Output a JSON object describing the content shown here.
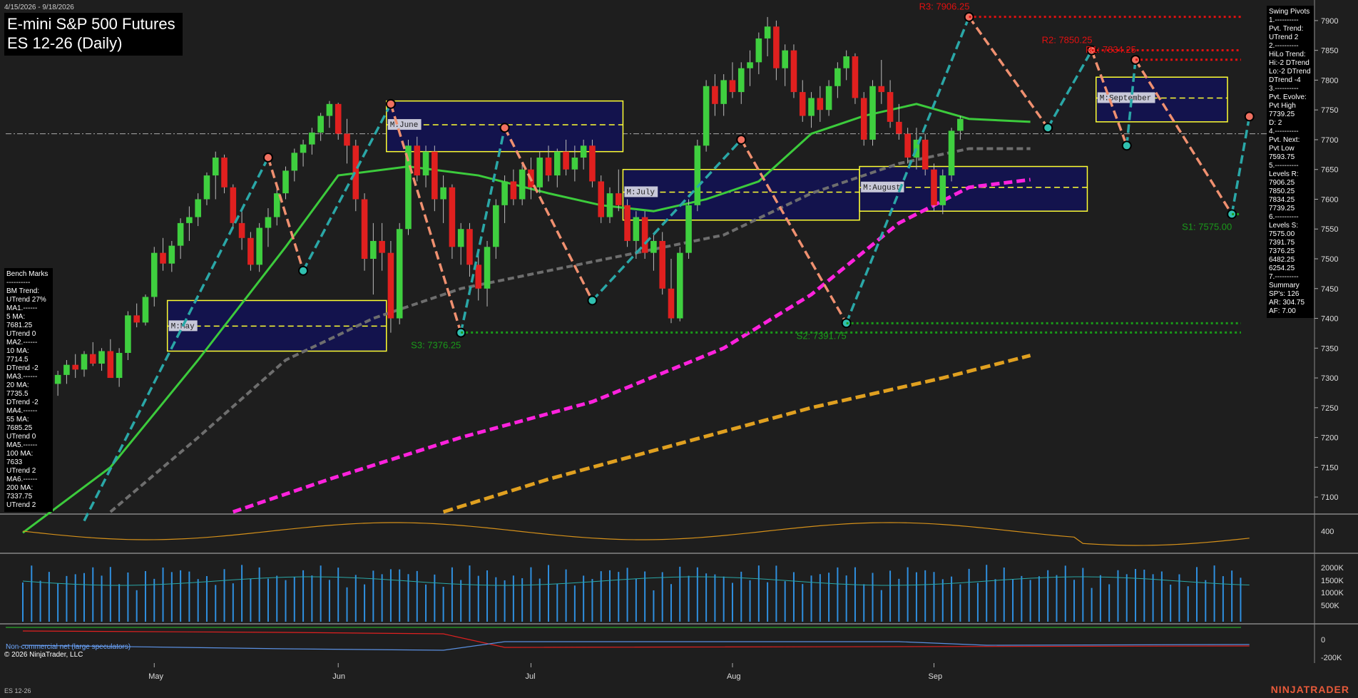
{
  "header": {
    "date_range": "4/15/2026 - 9/18/2026",
    "title_line1": "E-mini S&P 500 Futures",
    "title_line2": "ES 12-26 (Daily)"
  },
  "benchmarks": {
    "lines": [
      "Bench Marks",
      "----------",
      "BM Trend:",
      "UTrend 27%",
      "MA1.------",
      "5 MA:",
      "7681.25",
      "UTrend 0",
      "MA2.------",
      "10 MA:",
      "7714.5",
      "DTrend -2",
      "MA3.------",
      "20 MA:",
      "7735.5",
      "DTrend -2",
      "MA4.------",
      "55 MA:",
      "7685.25",
      "UTrend 0",
      "MA5.------",
      "100 MA:",
      "7633",
      "UTrend 2",
      "MA6.------",
      "200 MA:",
      "7337.75",
      "UTrend 2"
    ]
  },
  "swing_pivots": {
    "lines": [
      "Swing Pivots",
      "1.----------",
      "Pvt. Trend:",
      "UTrend 2",
      "2.----------",
      "HiLo Trend:",
      "Hi:-2 DTrend",
      "Lo:-2 DTrend",
      "DTrend -4",
      "3.----------",
      "Pvt. Evolve:",
      "Pvt High",
      "7739.25",
      "D: 2",
      "4.----------",
      "Pvt. Next:",
      "Pvt Low",
      "7593.75",
      "5.----------",
      "Levels R:",
      "7906.25",
      "7850.25",
      "7834.25",
      "7739.25",
      "6.----------",
      "Levels S:",
      "7575.00",
      "7391.75",
      "7376.25",
      "6482.25",
      "6254.25",
      "7.----------",
      "Summary",
      "SP's: 126",
      "AR: 304.75",
      "AF: 7.00"
    ]
  },
  "footer": {
    "symbol": "ES 12-26",
    "copyright": "© 2026 NinjaTrader, LLC",
    "cot_label": "Non-commercial net (large speculators)",
    "brand": "NINJATRADER"
  },
  "colors": {
    "background": "#1e1e1e",
    "up_candle": "#3fcf3f",
    "down_candle": "#e0201f",
    "ma20": "#3ccb3c",
    "ma55": "#6e6e6e",
    "ma100": "#ff22dd",
    "ma200": "#e0a020",
    "swing_up": "#2aa7a7",
    "swing_down": "#f09070",
    "resistance": "#e01010",
    "support": "#1a9a1a",
    "value_area_fill": "#13134d",
    "value_area_border": "#ffff33",
    "volume": "#2f8fdf"
  },
  "chart_data": {
    "type": "candlestick",
    "title": "E-mini S&P 500 Futures ES 12-26 (Daily)",
    "x_axis": {
      "months": [
        {
          "label": "May",
          "bar": 15
        },
        {
          "label": "Jun",
          "bar": 36
        },
        {
          "label": "Jul",
          "bar": 58
        },
        {
          "label": "Aug",
          "bar": 81
        },
        {
          "label": "Sep",
          "bar": 104
        }
      ]
    },
    "y_axis": {
      "ticks": [
        7100,
        7150,
        7200,
        7250,
        7300,
        7350,
        7400,
        7450,
        7500,
        7550,
        7600,
        7650,
        7700,
        7750,
        7800,
        7850,
        7900
      ],
      "range": [
        7075,
        7925
      ]
    },
    "close_line": 7710,
    "ohlc": [
      [
        7292,
        7315,
        7248,
        7262
      ],
      [
        7262,
        7288,
        7230,
        7280
      ],
      [
        7280,
        7302,
        7268,
        7298
      ],
      [
        7298,
        7326,
        7286,
        7290
      ],
      [
        7290,
        7312,
        7270,
        7305
      ],
      [
        7305,
        7330,
        7290,
        7322
      ],
      [
        7322,
        7340,
        7300,
        7314
      ],
      [
        7314,
        7345,
        7302,
        7340
      ],
      [
        7340,
        7360,
        7320,
        7324
      ],
      [
        7324,
        7350,
        7312,
        7345
      ],
      [
        7345,
        7365,
        7322,
        7300
      ],
      [
        7300,
        7350,
        7285,
        7342
      ],
      [
        7342,
        7412,
        7330,
        7405
      ],
      [
        7405,
        7425,
        7385,
        7393
      ],
      [
        7393,
        7440,
        7388,
        7436
      ],
      [
        7436,
        7520,
        7420,
        7510
      ],
      [
        7510,
        7535,
        7480,
        7492
      ],
      [
        7492,
        7530,
        7478,
        7522
      ],
      [
        7522,
        7568,
        7500,
        7560
      ],
      [
        7560,
        7588,
        7530,
        7570
      ],
      [
        7570,
        7610,
        7555,
        7600
      ],
      [
        7600,
        7645,
        7590,
        7640
      ],
      [
        7640,
        7680,
        7600,
        7670
      ],
      [
        7670,
        7675,
        7610,
        7620
      ],
      [
        7620,
        7625,
        7552,
        7560
      ],
      [
        7560,
        7580,
        7515,
        7535
      ],
      [
        7535,
        7545,
        7480,
        7490
      ],
      [
        7490,
        7560,
        7478,
        7552
      ],
      [
        7552,
        7585,
        7520,
        7570
      ],
      [
        7570,
        7620,
        7556,
        7610
      ],
      [
        7610,
        7655,
        7600,
        7648
      ],
      [
        7648,
        7685,
        7630,
        7678
      ],
      [
        7678,
        7700,
        7655,
        7692
      ],
      [
        7692,
        7720,
        7675,
        7712
      ],
      [
        7712,
        7745,
        7698,
        7740
      ],
      [
        7740,
        7765,
        7720,
        7760
      ],
      [
        7760,
        7762,
        7700,
        7710
      ],
      [
        7710,
        7735,
        7660,
        7690
      ],
      [
        7690,
        7700,
        7580,
        7600
      ],
      [
        7600,
        7610,
        7480,
        7500
      ],
      [
        7500,
        7560,
        7440,
        7530
      ],
      [
        7530,
        7560,
        7480,
        7510
      ],
      [
        7510,
        7530,
        7376,
        7400
      ],
      [
        7400,
        7560,
        7390,
        7550
      ],
      [
        7550,
        7700,
        7540,
        7690
      ],
      [
        7690,
        7705,
        7630,
        7640
      ],
      [
        7640,
        7690,
        7620,
        7680
      ],
      [
        7680,
        7690,
        7580,
        7600
      ],
      [
        7600,
        7640,
        7560,
        7620
      ],
      [
        7620,
        7625,
        7500,
        7520
      ],
      [
        7520,
        7560,
        7490,
        7550
      ],
      [
        7550,
        7560,
        7470,
        7490
      ],
      [
        7490,
        7510,
        7430,
        7450
      ],
      [
        7450,
        7530,
        7420,
        7520
      ],
      [
        7520,
        7600,
        7500,
        7590
      ],
      [
        7590,
        7640,
        7560,
        7630
      ],
      [
        7630,
        7650,
        7590,
        7600
      ],
      [
        7600,
        7660,
        7590,
        7650
      ],
      [
        7650,
        7670,
        7600,
        7620
      ],
      [
        7620,
        7680,
        7610,
        7670
      ],
      [
        7670,
        7690,
        7630,
        7640
      ],
      [
        7640,
        7685,
        7620,
        7680
      ],
      [
        7680,
        7700,
        7640,
        7650
      ],
      [
        7650,
        7690,
        7630,
        7670
      ],
      [
        7670,
        7700,
        7650,
        7690
      ],
      [
        7690,
        7700,
        7620,
        7630
      ],
      [
        7630,
        7640,
        7560,
        7570
      ],
      [
        7570,
        7620,
        7560,
        7610
      ],
      [
        7610,
        7650,
        7580,
        7590
      ],
      [
        7590,
        7600,
        7520,
        7530
      ],
      [
        7530,
        7580,
        7500,
        7570
      ],
      [
        7570,
        7580,
        7500,
        7510
      ],
      [
        7510,
        7540,
        7480,
        7530
      ],
      [
        7530,
        7545,
        7440,
        7450
      ],
      [
        7450,
        7500,
        7392,
        7400
      ],
      [
        7400,
        7520,
        7395,
        7510
      ],
      [
        7510,
        7600,
        7500,
        7590
      ],
      [
        7590,
        7700,
        7580,
        7690
      ],
      [
        7690,
        7800,
        7680,
        7790
      ],
      [
        7790,
        7810,
        7740,
        7760
      ],
      [
        7760,
        7810,
        7740,
        7800
      ],
      [
        7800,
        7830,
        7770,
        7780
      ],
      [
        7780,
        7830,
        7760,
        7820
      ],
      [
        7820,
        7850,
        7790,
        7830
      ],
      [
        7830,
        7880,
        7810,
        7870
      ],
      [
        7870,
        7906,
        7840,
        7890
      ],
      [
        7890,
        7900,
        7800,
        7820
      ],
      [
        7820,
        7860,
        7790,
        7850
      ],
      [
        7850,
        7860,
        7770,
        7780
      ],
      [
        7780,
        7800,
        7730,
        7740
      ],
      [
        7740,
        7780,
        7720,
        7770
      ],
      [
        7770,
        7790,
        7730,
        7750
      ],
      [
        7750,
        7800,
        7740,
        7790
      ],
      [
        7790,
        7830,
        7770,
        7820
      ],
      [
        7820,
        7850,
        7800,
        7840
      ],
      [
        7840,
        7845,
        7760,
        7770
      ],
      [
        7770,
        7780,
        7690,
        7700
      ],
      [
        7700,
        7800,
        7690,
        7790
      ],
      [
        7790,
        7834,
        7760,
        7780
      ],
      [
        7780,
        7800,
        7720,
        7730
      ],
      [
        7730,
        7760,
        7700,
        7710
      ],
      [
        7710,
        7720,
        7660,
        7670
      ],
      [
        7670,
        7720,
        7650,
        7700
      ],
      [
        7700,
        7710,
        7640,
        7650
      ],
      [
        7650,
        7660,
        7580,
        7590
      ],
      [
        7590,
        7650,
        7575,
        7640
      ],
      [
        7640,
        7720,
        7630,
        7715
      ],
      [
        7715,
        7740,
        7700,
        7735
      ]
    ],
    "moving_averages": [
      {
        "name": "20 MA",
        "values": [
          [
            0,
            7040
          ],
          [
            10,
            7150
          ],
          [
            20,
            7330
          ],
          [
            30,
            7520
          ],
          [
            36,
            7640
          ],
          [
            44,
            7655
          ],
          [
            52,
            7640
          ],
          [
            60,
            7610
          ],
          [
            66,
            7590
          ],
          [
            72,
            7580
          ],
          [
            78,
            7600
          ],
          [
            84,
            7630
          ],
          [
            90,
            7710
          ],
          [
            96,
            7740
          ],
          [
            102,
            7760
          ],
          [
            108,
            7735
          ],
          [
            115,
            7730
          ]
        ]
      },
      {
        "name": "55 MA",
        "values": [
          [
            10,
            7075
          ],
          [
            20,
            7200
          ],
          [
            30,
            7330
          ],
          [
            40,
            7400
          ],
          [
            50,
            7450
          ],
          [
            60,
            7480
          ],
          [
            70,
            7510
          ],
          [
            80,
            7540
          ],
          [
            90,
            7610
          ],
          [
            100,
            7660
          ],
          [
            108,
            7685
          ],
          [
            115,
            7685
          ]
        ]
      },
      {
        "name": "100 MA",
        "values": [
          [
            24,
            7075
          ],
          [
            35,
            7130
          ],
          [
            50,
            7200
          ],
          [
            65,
            7260
          ],
          [
            80,
            7350
          ],
          [
            90,
            7440
          ],
          [
            100,
            7560
          ],
          [
            108,
            7620
          ],
          [
            115,
            7633
          ]
        ]
      },
      {
        "name": "200 MA",
        "values": [
          [
            48,
            7075
          ],
          [
            60,
            7130
          ],
          [
            75,
            7190
          ],
          [
            90,
            7250
          ],
          [
            105,
            7300
          ],
          [
            115,
            7337.75
          ]
        ]
      }
    ],
    "swing_legs": [
      {
        "dir": "up",
        "from": [
          7,
          7060
        ],
        "to": [
          28,
          7670
        ]
      },
      {
        "dir": "down",
        "from": [
          28,
          7670
        ],
        "to": [
          32,
          7480
        ]
      },
      {
        "dir": "up",
        "from": [
          32,
          7480
        ],
        "to": [
          42,
          7760
        ]
      },
      {
        "dir": "down",
        "from": [
          42,
          7760
        ],
        "to": [
          50,
          7376
        ]
      },
      {
        "dir": "up",
        "from": [
          50,
          7376
        ],
        "to": [
          55,
          7720
        ]
      },
      {
        "dir": "down",
        "from": [
          55,
          7720
        ],
        "to": [
          65,
          7430
        ]
      },
      {
        "dir": "up",
        "from": [
          65,
          7430
        ],
        "to": [
          82,
          7700
        ]
      },
      {
        "dir": "down",
        "from": [
          82,
          7700
        ],
        "to": [
          94,
          7392
        ]
      },
      {
        "dir": "up",
        "from": [
          94,
          7392
        ],
        "to": [
          108,
          7906
        ]
      },
      {
        "dir": "down",
        "from": [
          108,
          7906
        ],
        "to": [
          117,
          7720
        ]
      },
      {
        "dir": "up",
        "from": [
          117,
          7720
        ],
        "to": [
          122,
          7850
        ]
      },
      {
        "dir": "down",
        "from": [
          122,
          7850
        ],
        "to": [
          126,
          7690
        ]
      },
      {
        "dir": "up",
        "from": [
          126,
          7690
        ],
        "to": [
          127,
          7834
        ]
      },
      {
        "dir": "down",
        "from": [
          127,
          7834
        ],
        "to": [
          138,
          7575
        ]
      },
      {
        "dir": "up",
        "from": [
          138,
          7575
        ],
        "to": [
          140,
          7739
        ]
      }
    ],
    "levels": [
      {
        "label": "R3: 7906.25",
        "value": 7906.25,
        "kind": "resistance",
        "from_bar": 108
      },
      {
        "label": "R2: 7850.25",
        "value": 7850.25,
        "kind": "resistance",
        "from_bar": 122
      },
      {
        "label": "R1: 7834.25",
        "value": 7834.25,
        "kind": "resistance",
        "from_bar": 127
      },
      {
        "label": "S1: 7575.00",
        "value": 7575.0,
        "kind": "support",
        "from_bar": 138
      },
      {
        "label": "S2: 7391.75",
        "value": 7391.75,
        "kind": "support",
        "from_bar": 94
      },
      {
        "label": "S3: 7376.25",
        "value": 7376.25,
        "kind": "support",
        "from_bar": 50
      }
    ],
    "value_areas": [
      {
        "label": "M:May",
        "bar_from": 17,
        "bar_to": 41,
        "low": 7345,
        "high": 7430,
        "mid": 7387
      },
      {
        "label": "M:June",
        "bar_from": 42,
        "bar_to": 68,
        "low": 7680,
        "high": 7765,
        "mid": 7725
      },
      {
        "label": "M:July",
        "bar_from": 69,
        "bar_to": 95,
        "low": 7565,
        "high": 7650,
        "mid": 7612
      },
      {
        "label": "M:August",
        "bar_from": 96,
        "bar_to": 121,
        "low": 7580,
        "high": 7655,
        "mid": 7620
      },
      {
        "label": "M:September",
        "bar_from": 123,
        "bar_to": 137,
        "low": 7730,
        "high": 7805,
        "mid": 7770
      }
    ],
    "oscillator": {
      "y_tick": "400"
    },
    "volume": {
      "y_ticks": [
        "2000K",
        "1500K",
        "1000K",
        "500K"
      ]
    },
    "cot": {
      "y_ticks": [
        "0",
        "-200K"
      ]
    }
  }
}
